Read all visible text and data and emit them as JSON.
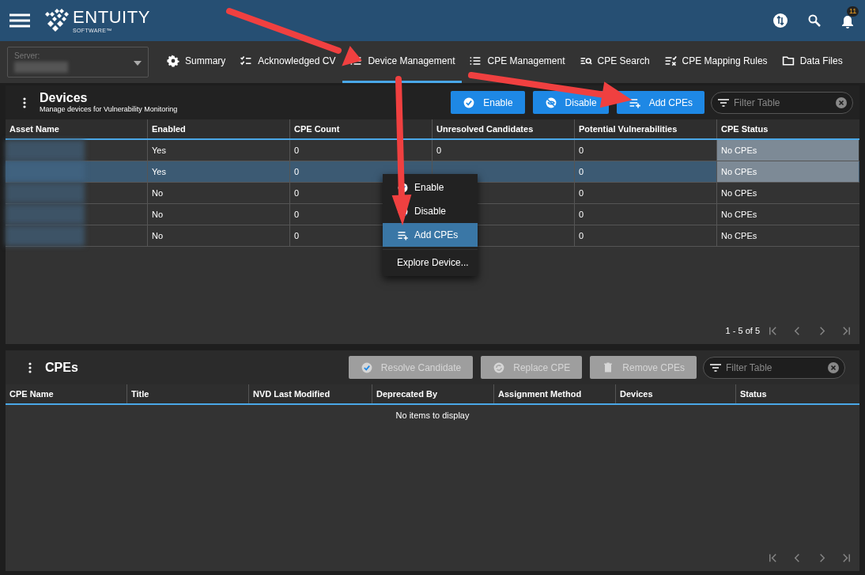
{
  "header": {
    "logo_text": "ENTUITY",
    "logo_subtext": "SOFTWARE™",
    "notification_count": "11"
  },
  "server": {
    "label": "Server:"
  },
  "tabs": [
    {
      "label": "Summary",
      "selected": false
    },
    {
      "label": "Acknowledged CV",
      "selected": false
    },
    {
      "label": "Device Management",
      "selected": true
    },
    {
      "label": "CPE Management",
      "selected": false
    },
    {
      "label": "CPE Search",
      "selected": false
    },
    {
      "label": "CPE Mapping Rules",
      "selected": false
    },
    {
      "label": "Data Files",
      "selected": false
    }
  ],
  "devices": {
    "title": "Devices",
    "subtitle": "Manage devices for Vulnerability Monitoring",
    "buttons": [
      {
        "label": "Enable",
        "disabled": false
      },
      {
        "label": "Disable",
        "disabled": false
      },
      {
        "label": "Add CPEs",
        "disabled": false
      }
    ],
    "filter": {
      "placeholder": "Filter Table"
    },
    "columns": [
      "Asset Name",
      "Enabled",
      "CPE Count",
      "Unresolved Candidates",
      "Potential Vulnerabilities",
      "CPE Status"
    ],
    "rows": [
      {
        "enabled": "Yes",
        "cpe_count": "0",
        "unresolved": "0",
        "vulnerabilities": "0",
        "status": "No CPEs",
        "selected": false,
        "status_marked": true
      },
      {
        "enabled": "Yes",
        "cpe_count": "0",
        "vulnerabilities": "0",
        "status": "No CPEs",
        "selected": true,
        "status_marked": true
      },
      {
        "enabled": "No",
        "cpe_count": "0",
        "vulnerabilities": "0",
        "status": "No CPEs",
        "selected": false,
        "status_marked": false
      },
      {
        "enabled": "No",
        "cpe_count": "0",
        "vulnerabilities": "0",
        "status": "No CPEs",
        "selected": false,
        "status_marked": false
      },
      {
        "enabled": "No",
        "cpe_count": "0",
        "vulnerabilities": "0",
        "status": "No CPEs",
        "selected": false,
        "status_marked": false
      }
    ],
    "pagination": "1 - 5 of 5"
  },
  "context_menu": [
    {
      "label": "Enable",
      "selected": false
    },
    {
      "label": "Disable",
      "selected": false
    },
    {
      "label": "Add CPEs",
      "selected": true
    },
    {
      "label": "Explore Device...",
      "selected": false
    }
  ],
  "cpes": {
    "title": "CPEs",
    "buttons": [
      {
        "label": "Resolve Candidate",
        "disabled": true
      },
      {
        "label": "Replace CPE",
        "disabled": true
      },
      {
        "label": "Remove CPEs",
        "disabled": true
      }
    ],
    "filter": {
      "placeholder": "Filter Table"
    },
    "columns": [
      "CPE Name",
      "Title",
      "NVD Last Modified",
      "Deprecated By",
      "Assignment Method",
      "Devices",
      "Status"
    ],
    "empty_text": "No items to display"
  }
}
